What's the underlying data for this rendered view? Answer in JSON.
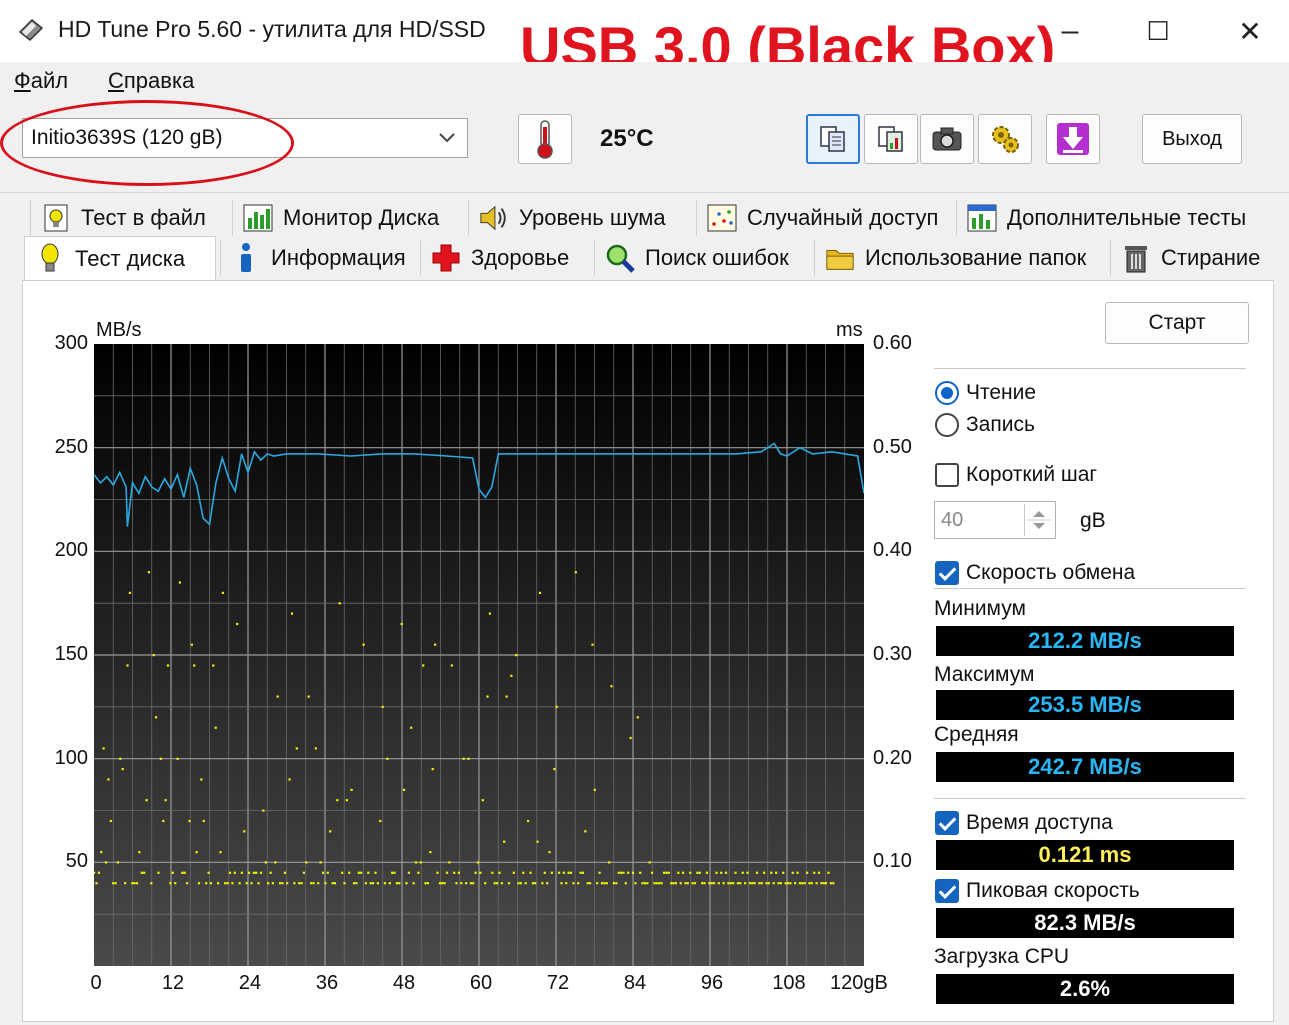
{
  "window": {
    "title": "HD Tune Pro 5.60 - утилита для HD/SSD",
    "overlay_label": "USB 3.0 (Black Box)",
    "minimize": "–",
    "maximize": "☐",
    "close": "✕"
  },
  "menu": {
    "file_first": "Ф",
    "file_rest": "айл",
    "help_first": "С",
    "help_rest": "правка"
  },
  "toolbar": {
    "drive": "Initio3639S (120 gB)",
    "temperature": "25°C",
    "exit_label": "Выход"
  },
  "tabs_row1": [
    {
      "label": "Тест в файл",
      "icon": "file-test-icon"
    },
    {
      "label": "Монитор Диска",
      "icon": "disk-monitor-icon"
    },
    {
      "label": "Уровень шума",
      "icon": "speaker-icon"
    },
    {
      "label": "Случайный доступ",
      "icon": "random-access-icon"
    },
    {
      "label": "Дополнительные  тесты",
      "icon": "extra-tests-icon"
    }
  ],
  "tabs_row2": [
    {
      "label": "Тест диска",
      "icon": "bulb-icon",
      "selected": true
    },
    {
      "label": "Информация",
      "icon": "info-icon"
    },
    {
      "label": "Здоровье",
      "icon": "health-cross-icon"
    },
    {
      "label": "Поиск ошибок",
      "icon": "magnifier-icon"
    },
    {
      "label": "Использование папок",
      "icon": "folder-icon"
    },
    {
      "label": "Стирание",
      "icon": "trash-icon"
    }
  ],
  "controls": {
    "start_label": "Старт",
    "read_label": "Чтение",
    "write_label": "Запись",
    "read_selected": true,
    "short_step_label": "Короткий шаг",
    "short_step_checked": false,
    "step_value": "40",
    "step_unit": "gB",
    "transfer_rate_label": "Скорость обмена",
    "transfer_rate_checked": true,
    "min_label": "Минимум",
    "min_value": "212.2 MB/s",
    "max_label": "Максимум",
    "max_value": "253.5 MB/s",
    "avg_label": "Средняя",
    "avg_value": "242.7 MB/s",
    "access_time_label": "Время доступа",
    "access_time_checked": true,
    "access_time_value": "0.121 ms",
    "burst_label": "Пиковая скорость",
    "burst_checked": true,
    "burst_value": "82.3 MB/s",
    "cpu_label": "Загрузка CPU",
    "cpu_value": "2.6%"
  },
  "colors": {
    "transfer_line": "#29a9e0",
    "access_points": "#f2f200",
    "overlay_text": "#e0141e",
    "ellipse": "#d8101a"
  },
  "chart_data": {
    "type": "line",
    "left_axis_unit": "MB/s",
    "right_axis_unit": "ms",
    "x_ticks": [
      "0",
      "12",
      "24",
      "36",
      "48",
      "60",
      "72",
      "84",
      "96",
      "108",
      "120gB"
    ],
    "y_ticks_left": [
      "300",
      "250",
      "200",
      "150",
      "100",
      "50"
    ],
    "y_ticks_right": [
      "0.60",
      "0.50",
      "0.40",
      "0.30",
      "0.20",
      "0.10"
    ],
    "xlim": [
      0,
      120
    ],
    "ylim_left": [
      0,
      300
    ],
    "ylim_right": [
      0,
      0.6
    ],
    "grid": true,
    "series": [
      {
        "kind": "transfer_rate",
        "x": [
          0,
          1,
          2,
          3,
          4,
          5,
          5.2,
          6,
          7,
          8,
          9,
          10,
          11,
          12,
          13,
          14,
          15,
          16,
          17,
          18,
          19,
          20,
          21,
          22,
          23,
          24,
          25,
          26,
          27,
          28,
          30,
          35,
          40,
          45,
          50,
          55,
          59,
          60,
          61,
          62,
          63,
          64,
          70,
          80,
          90,
          100,
          104,
          106,
          107,
          108,
          110,
          112,
          115,
          119,
          120
        ],
        "y": [
          237,
          233,
          236,
          232,
          238,
          231,
          212,
          233,
          228,
          236,
          231,
          229,
          235,
          230,
          237,
          226,
          240,
          232,
          216,
          213,
          233,
          245,
          235,
          229,
          247,
          238,
          248,
          244,
          247,
          246,
          247,
          247,
          246,
          247,
          247,
          246,
          245,
          230,
          226,
          231,
          247,
          247,
          247,
          247,
          247,
          247,
          248,
          252,
          247,
          246,
          250,
          247,
          248,
          246,
          228
        ]
      },
      {
        "kind": "access_time_ms",
        "values": [
          0.09,
          0.08,
          0.09,
          0.11,
          0.21,
          0.1,
          0.18,
          0.14,
          0.08,
          0.08,
          0.1,
          0.2,
          0.19,
          0.08,
          0.29,
          0.36,
          0.08,
          0.08,
          0.08,
          0.11,
          0.09,
          0.09,
          0.16,
          0.38,
          0.08,
          0.3,
          0.24,
          0.09,
          0.2,
          0.14,
          0.16,
          0.29,
          0.08,
          0.09,
          0.08,
          0.2,
          0.37,
          0.09,
          0.09,
          0.08,
          0.14,
          0.31,
          0.29,
          0.11,
          0.08,
          0.18,
          0.14,
          0.08,
          0.09,
          0.08,
          0.29,
          0.23,
          0.08,
          0.11,
          0.36,
          0.08,
          0.08,
          0.09,
          0.08,
          0.09,
          0.33,
          0.08,
          0.09,
          0.13,
          0.08,
          0.09,
          0.08,
          0.09,
          0.09,
          0.08,
          0.09,
          0.15,
          0.1,
          0.08,
          0.09,
          0.08,
          0.1,
          0.26,
          0.08,
          0.08,
          0.09,
          0.08,
          0.18,
          0.34,
          0.08,
          0.21,
          0.08,
          0.08,
          0.09,
          0.1,
          0.26,
          0.08,
          0.08,
          0.21,
          0.08,
          0.1,
          0.09,
          0.08,
          0.09,
          0.13,
          0.08,
          0.08,
          0.16,
          0.35,
          0.09,
          0.08,
          0.16,
          0.09,
          0.17,
          0.08,
          0.08,
          0.09,
          0.09,
          0.31,
          0.08,
          0.09,
          0.08,
          0.08,
          0.09,
          0.08,
          0.14,
          0.25,
          0.08,
          0.2,
          0.08,
          0.09,
          0.09,
          0.08,
          0.08,
          0.33,
          0.17,
          0.08,
          0.09,
          0.23,
          0.08,
          0.1,
          0.09,
          0.1,
          0.29,
          0.08,
          0.08,
          0.11,
          0.19,
          0.31,
          0.09,
          0.08,
          0.08,
          0.08,
          0.09,
          0.1,
          0.29,
          0.09,
          0.08,
          0.09,
          0.08,
          0.2,
          0.08,
          0.2,
          0.08,
          0.08,
          0.09,
          0.1,
          0.09,
          0.16,
          0.08,
          0.26,
          0.34,
          0.09,
          0.08,
          0.08,
          0.09,
          0.08,
          0.12,
          0.26,
          0.08,
          0.28,
          0.09,
          0.3,
          0.08,
          0.08,
          0.09,
          0.08,
          0.14,
          0.09,
          0.08,
          0.08,
          0.12,
          0.36,
          0.08,
          0.09,
          0.08,
          0.11,
          0.09,
          0.19,
          0.25,
          0.09,
          0.08,
          0.09,
          0.08,
          0.09,
          0.09,
          0.08,
          0.38,
          0.08,
          0.09,
          0.09,
          0.13,
          0.08,
          0.08,
          0.31,
          0.17,
          0.08,
          0.09,
          0.08,
          0.08,
          0.08,
          0.1,
          0.27,
          0.08,
          0.08,
          0.09,
          0.09,
          0.09,
          0.08,
          0.09,
          0.22,
          0.09,
          0.08,
          0.24,
          0.09,
          0.08,
          0.08,
          0.08,
          0.1,
          0.09,
          0.08,
          0.08,
          0.08,
          0.08,
          0.09,
          0.09,
          0.09,
          0.08,
          0.08,
          0.08,
          0.09,
          0.08,
          0.09,
          0.08,
          0.08,
          0.09,
          0.08,
          0.08,
          0.09,
          0.09,
          0.08,
          0.08,
          0.09,
          0.08,
          0.08,
          0.08,
          0.09,
          0.08,
          0.09,
          0.08,
          0.09,
          0.08,
          0.08,
          0.08,
          0.09,
          0.08,
          0.08,
          0.09,
          0.08,
          0.09,
          0.08,
          0.08,
          0.08,
          0.09,
          0.08,
          0.08,
          0.09,
          0.08,
          0.08,
          0.09,
          0.08,
          0.09,
          0.08,
          0.08,
          0.09,
          0.08,
          0.08,
          0.08,
          0.09,
          0.08,
          0.09,
          0.08,
          0.08,
          0.08,
          0.09,
          0.08,
          0.08,
          0.09,
          0.08,
          0.09,
          0.08,
          0.08,
          0.08,
          0.09,
          0.08,
          0.08
        ]
      }
    ]
  }
}
